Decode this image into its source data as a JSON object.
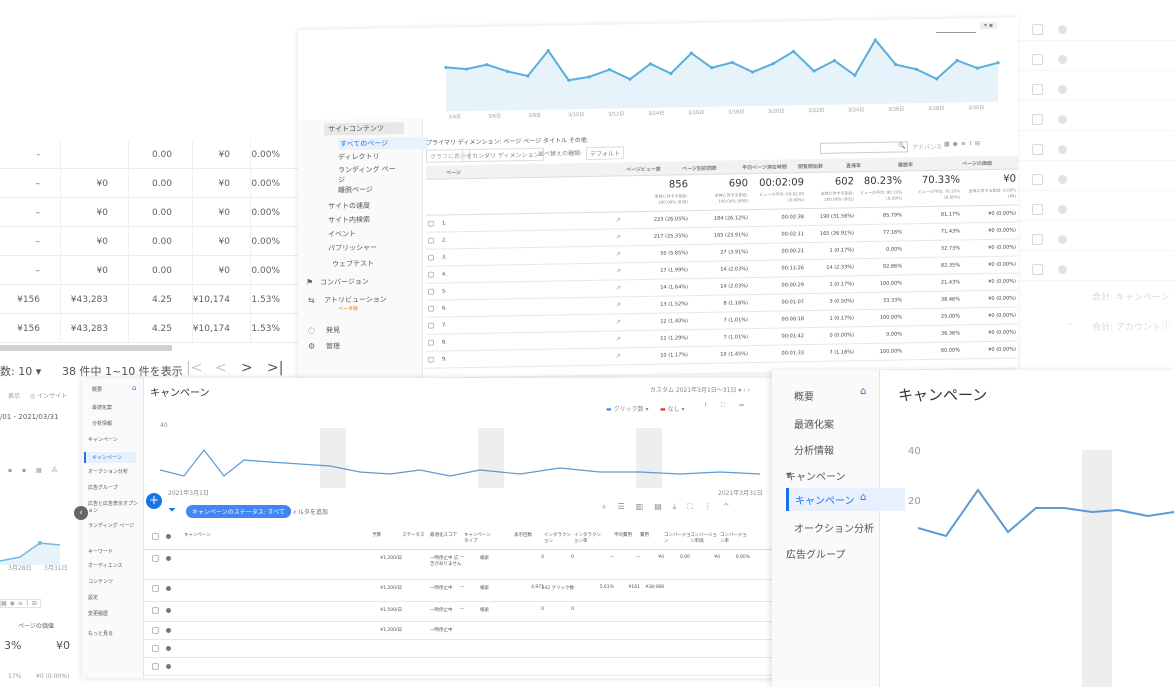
{
  "left_table": {
    "rows": [
      {
        "c1": "-",
        "c2": "",
        "c3": "0.00",
        "c4": "¥0",
        "c5": "0.00%"
      },
      {
        "c1": "–",
        "c2": "¥0",
        "c3": "0.00",
        "c4": "¥0",
        "c5": "0.00%"
      },
      {
        "c1": "–",
        "c2": "¥0",
        "c3": "0.00",
        "c4": "¥0",
        "c5": "0.00%"
      },
      {
        "c1": "–",
        "c2": "¥0",
        "c3": "0.00",
        "c4": "¥0",
        "c5": "0.00%"
      },
      {
        "c1": "–",
        "c2": "¥0",
        "c3": "0.00",
        "c4": "¥0",
        "c5": "0.00%"
      },
      {
        "c1": "¥156",
        "c2": "¥43,283",
        "c3": "4.25",
        "c4": "¥10,174",
        "c5": "1.53%"
      },
      {
        "c1": "¥156",
        "c2": "¥43,283",
        "c3": "4.25",
        "c4": "¥10,174",
        "c5": "1.53%"
      }
    ],
    "rows_label": "数: 10",
    "pager_text": "38 件中 1~10 件を表示"
  },
  "analytics": {
    "sidebar": [
      "サイトコンテンツ",
      "すべてのページ",
      "ディレクトリ",
      "ランディング ページ",
      "離脱ページ",
      "サイトの速度",
      "サイト内検索",
      "イベント",
      "パブリッシャー",
      "ウェブテスト",
      "コンバージョン",
      "アトリビューション",
      "発見",
      "管理"
    ],
    "sidebar_badge": "ベータ版",
    "x_dates": [
      "3/4日",
      "3/5日",
      "3/6日",
      "3/7日",
      "3/8日",
      "3/9日",
      "3/10日",
      "3/11日",
      "3/12日",
      "3/13日",
      "3/14日",
      "3/15日",
      "3/16日",
      "3/17日",
      "3/18日",
      "3/19日",
      "3/20日",
      "3/21日",
      "3/22日",
      "3/23日",
      "3/24日",
      "3/25日",
      "3/26日",
      "3/27日",
      "3/28日",
      "3/29日",
      "3/30日",
      "3/31日"
    ],
    "chart_data": {
      "type": "line",
      "values": [
        40,
        38,
        42,
        35,
        30,
        55,
        25,
        28,
        35,
        25,
        40,
        30,
        50,
        35,
        40,
        30,
        38,
        50,
        30,
        40,
        25,
        60,
        35,
        30,
        20,
        38,
        30,
        35
      ]
    },
    "dimension_label": "プライマリ ディメンション: ページ  ページ タイトル  その他",
    "controls": [
      "グラフに表示",
      "セカンダリ ディメンション",
      "並べ替えの種類:",
      "デフォルト"
    ],
    "advanced": "アドバンス",
    "headers": [
      "ページ",
      "ページビュー数",
      "ページ別訪問数",
      "平均ページ滞在時間",
      "閲覧開始数",
      "直帰率",
      "離脱率",
      "ページの価値"
    ],
    "totals": [
      "856",
      "690",
      "00:02:09",
      "602",
      "80.23%",
      "70.33%",
      "¥0"
    ],
    "total_subs": [
      "全体に対する割合: 100.00% (856)",
      "全体に対する割合: 100.00% (690)",
      "ビューの平均: 00:02:09 (0.00%)",
      "全体に対する割合: 100.00% (602)",
      "ビューの平均: 80.23% (0.00%)",
      "ビューの平均: 70.33% (0.00%)",
      "全体に対する割合: 0.00% (¥0)"
    ],
    "rows": [
      [
        "1.",
        "223 (26.05%)",
        "184 (26.12%)",
        "00:02:38",
        "190 (31.56%)",
        "85.79%",
        "81.17%",
        "¥0 (0.00%)"
      ],
      [
        "2.",
        "217 (25.35%)",
        "165 (23.91%)",
        "00:02:11",
        "165 (26.91%)",
        "77.16%",
        "71.43%",
        "¥0 (0.00%)"
      ],
      [
        "3.",
        "50 (5.85%)",
        "27 (3.91%)",
        "00:00:21",
        "1 (0.17%)",
        "0.00%",
        "32.73%",
        "¥0 (0.00%)"
      ],
      [
        "4.",
        "17 (1.99%)",
        "14 (2.03%)",
        "00:11:26",
        "14 (2.33%)",
        "92.86%",
        "82.35%",
        "¥0 (0.00%)"
      ],
      [
        "5.",
        "14 (1.64%)",
        "14 (2.03%)",
        "00:00:29",
        "1 (0.17%)",
        "100.00%",
        "21.43%",
        "¥0 (0.00%)"
      ],
      [
        "6.",
        "13 (1.52%)",
        "8 (1.16%)",
        "00:01:07",
        "3 (0.50%)",
        "33.33%",
        "38.46%",
        "¥0 (0.00%)"
      ],
      [
        "7.",
        "12 (1.40%)",
        "7 (1.01%)",
        "00:00:18",
        "1 (0.17%)",
        "100.00%",
        "25.00%",
        "¥0 (0.00%)"
      ],
      [
        "8.",
        "11 (1.29%)",
        "7 (1.01%)",
        "00:01:42",
        "0 (0.00%)",
        "0.00%",
        "36.36%",
        "¥0 (0.00%)"
      ],
      [
        "9.",
        "10 (1.17%)",
        "10 (1.45%)",
        "00:01:33",
        "7 (1.16%)",
        "100.00%",
        "60.00%",
        "¥0 (0.00%)"
      ]
    ]
  },
  "right_panel": {
    "items": [
      "合計: キャンペーン",
      "合計: アカウント"
    ]
  },
  "ads_small": {
    "nav": [
      "概要",
      "最適化案",
      "分析情報",
      "キャンペーン",
      "キャンペーン",
      "オークション分析",
      "広告グループ",
      "広告と広告表示オプション",
      "ランディング ページ",
      "キーワード",
      "オーディエンス",
      "コンテンツ",
      "設定",
      "変更履歴",
      "もっと見る"
    ],
    "title": "キャンペーン",
    "date": "カスタム 2021年3月1日〜31日",
    "legend": [
      "クリック数",
      "なし"
    ],
    "tools": [
      "グラフの表示",
      "展開",
      "全画面"
    ],
    "x_start": "2021年3月1日",
    "x_end": "2021年3月31日",
    "y_label": "40",
    "filter_chip": "キャンペーンのステータス: すべて",
    "filter_add": "フィルタを追加",
    "table_icons": [
      "検索",
      "分割",
      "表示項目",
      "レポート",
      "ダウンロード",
      "展開",
      "その他"
    ],
    "headers": [
      "キャンペーン",
      "予算",
      "ステータス",
      "最適化スコア",
      "キャンペーン タイプ",
      "表示回数",
      "インタラクション",
      "インタラクション率",
      "平均費用",
      "費用",
      "コンバージョン",
      "コンバージョン単価",
      "コンバージョン率"
    ],
    "rows": [
      {
        "budget": "¥1,200/日",
        "status": "一時停止中 広告がありません",
        "score": "—",
        "type": "検索",
        "imp": "0",
        "inter": "0",
        "rate": "—",
        "avg": "—",
        "cost": "¥0",
        "cv": "0.00",
        "cvcost": "¥0",
        "cvr": "0.00%"
      },
      {
        "budget": "¥1,200/日",
        "status": "一時停止中",
        "score": "—",
        "type": "検索",
        "imp": "4,971",
        "inter": "242 クリック数",
        "rate": "5.61%",
        "avg": "¥161",
        "cost": "¥38,988",
        "cv": "",
        "cvcost": "",
        "cvr": ""
      },
      {
        "budget": "¥1,500/日",
        "status": "一時停止中",
        "score": "—",
        "type": "検索",
        "imp": "0",
        "inter": "0",
        "rate": "",
        "avg": "",
        "cost": "",
        "cv": "",
        "cvcost": "",
        "cvr": ""
      },
      {
        "budget": "¥1,200/日",
        "status": "一時停止中",
        "score": "",
        "type": "",
        "imp": "",
        "inter": "",
        "rate": "",
        "avg": "",
        "cost": "",
        "cv": "",
        "cvcost": "",
        "cvr": ""
      }
    ]
  },
  "ads_large": {
    "nav": [
      "概要",
      "最適化案",
      "分析情報",
      "キャンペーン",
      "キャンペーン",
      "オークション分析",
      "広告グループ"
    ],
    "title": "キャンペーン",
    "y40": "40",
    "y20": "20"
  },
  "bottom_left": {
    "lines": [
      "表示",
      "インサイト",
      "/01 - 2021/03/31",
      "3月28日",
      "3月31日",
      "ページの価値",
      "3%",
      "¥0",
      "17%",
      "¥0 (0.00%)"
    ]
  }
}
